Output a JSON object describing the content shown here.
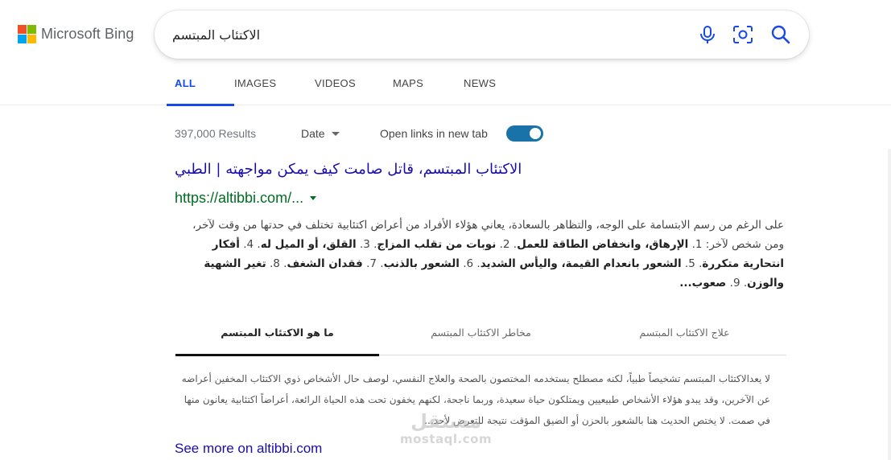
{
  "brand": {
    "name": "Microsoft Bing",
    "logo_colors": [
      "#f25022",
      "#7fba00",
      "#00a4ef",
      "#ffb900"
    ]
  },
  "search": {
    "query": "الاكتئاب المبتسم",
    "icons": [
      "microphone-icon",
      "visual-search-icon",
      "search-icon"
    ]
  },
  "tabs": [
    {
      "label": "ALL",
      "active": true
    },
    {
      "label": "IMAGES",
      "active": false
    },
    {
      "label": "VIDEOS",
      "active": false
    },
    {
      "label": "MAPS",
      "active": false
    },
    {
      "label": "NEWS",
      "active": false
    }
  ],
  "results_bar": {
    "count": "397,000 Results",
    "date_label": "Date",
    "open_links_label": "Open links in new tab",
    "open_links_on": true
  },
  "result": {
    "title": "الاكتئاب المبتسم، قاتل صامت كيف يمكن مواجهته | الطبي",
    "url": "https://altibbi.com/...",
    "snippet_lines": [
      "على الرغم من رسم الابتسامة على الوجه، والتظاهر بالسعادة، يعاني هؤلاء الأفراد من أعراض اكتئابية تختلف في حدتها",
      "من وقت لآخر، ومن شخص لآخر: 1. ",
      "الإرهاق، وانخفاض الطاقة للعمل",
      ". 2. ",
      "نوبات من تقلب المزاج",
      ". 3. ",
      "القلق، أو الميل له",
      ". 4. ",
      "أفكار انتحارية متكررة",
      ". 5. ",
      "الشعور بانعدام القيمة، واليأس الشديد",
      ". 6. ",
      "الشعور بالذنب",
      ". 7. ",
      "فقدان الشغف",
      ". 8. ",
      "تغير الشهية والوزن",
      ". 9. ",
      "صعوب..."
    ],
    "subtabs": [
      {
        "label": "ما هو الاكتئاب المبتسم",
        "active": true
      },
      {
        "label": "مخاطر الاكتئاب المبتسم",
        "active": false
      },
      {
        "label": "علاج الاكتئاب المبتسم",
        "active": false
      }
    ],
    "sub_snippet": "لا يعدالاكتئاب المبتسم تشخيصاً طبياً، لكنه مصطلح يستخدمه المختصون بالصحة والعلاج النفسي، لوصف حال الأشخاص ذوي الاكتئاب المخفين أعراضه عن الآخرين، وقد يبدو هؤلاء الأشخاص طبيعيين ويمتلكون حياة سعيدة، وربما ناجحة، لكنهم يخفون تحت هذه الحياة الرائعة، أعراضاً اكتئابية يعانون منها في صمت. لا يختص الحديث هنا بالشعور بالحزن أو الضيق المؤقت نتيجة للتعرض لأحد...",
    "see_more": "See more on altibbi.com"
  },
  "watermark": {
    "arabic": "مستقل",
    "latin": "mostaql.com"
  }
}
